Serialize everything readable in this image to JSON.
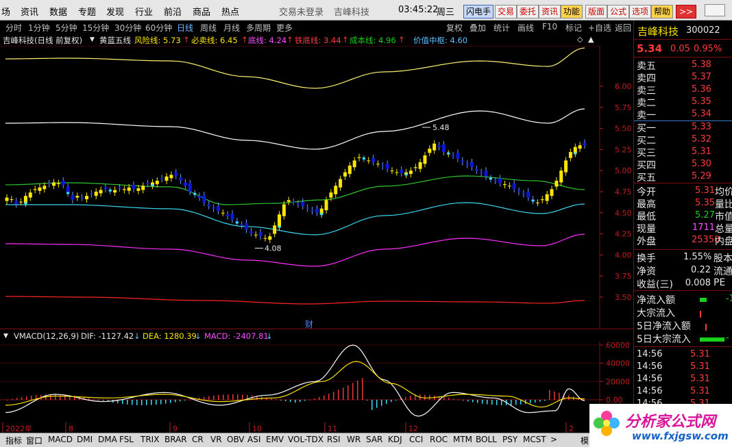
{
  "menubar": {
    "items": [
      "场",
      "资讯",
      "数据",
      "专题",
      "发现",
      "行业",
      "前沿",
      "商品",
      "热点"
    ],
    "login": "交易未登录",
    "company": "吉峰科技",
    "time": "03:45:22",
    "weekday": "周三",
    "buttons": [
      "闪电手",
      "交易",
      "委托",
      "资讯",
      "功能",
      "版面",
      "公式",
      "选项",
      "帮助",
      ">>"
    ]
  },
  "toolbar": {
    "periods": [
      "分时",
      "1分钟",
      "5分钟",
      "15分钟",
      "30分钟",
      "60分钟",
      "日线",
      "周线",
      "月线",
      "多周期",
      "更多"
    ],
    "active": "日线",
    "right": [
      "复权",
      "叠加",
      "统计",
      "画线",
      "F10",
      "标记",
      "+自选",
      "返回"
    ]
  },
  "infobar": {
    "title": "吉峰科技(日线 前复权)",
    "indicator": "黄蓝五线",
    "risk": "风险线: 5.73",
    "sell": "必卖线: 6.45",
    "bottom": "底线: 4.24",
    "iron": "铁底线: 3.44",
    "cost": "成本线: 4.96",
    "value": "价值中枢: 4.60",
    "arrow": "↑"
  },
  "main_chart": {
    "price_axis": [
      "6.00",
      "5.75",
      "5.50",
      "5.25",
      "5.00",
      "4.75",
      "4.50",
      "4.25",
      "4.00",
      "3.75",
      "3.50"
    ],
    "high_label": "5.48",
    "low_label": "4.08",
    "fin_marker": "财"
  },
  "macd": {
    "name": "VMACD(12,26,9)",
    "dif": "DIF: -1127.42",
    "dea": "DEA: 1280.39",
    "macd": "MACD: -2407.81",
    "axis": [
      "60000",
      "40000",
      "20000",
      "0.00"
    ],
    "dates": [
      "2022年",
      "8",
      "9",
      "10",
      "11",
      "12",
      "2"
    ]
  },
  "bottombar": {
    "tabs": [
      "指标",
      "窗口",
      "MACD",
      "DMI",
      "DMA",
      "FSL",
      "TRIX",
      "BRAR",
      "CR",
      "VR",
      "OBV",
      "ASI",
      "EMV",
      "VOL-TDX",
      "RSI",
      "WR",
      "SAR",
      "KDJ",
      "CCI",
      "ROC",
      "MTM",
      "BOLL",
      "PSY",
      "MCST",
      ">",
      "模"
    ]
  },
  "quote": {
    "name": "吉峰科技",
    "code": "300022",
    "price": "5.34",
    "change": "0.05",
    "pct": "0.95%",
    "asks": [
      {
        "label": "卖五",
        "price": "5.38"
      },
      {
        "label": "卖四",
        "price": "5.37"
      },
      {
        "label": "卖三",
        "price": "5.36"
      },
      {
        "label": "卖二",
        "price": "5.35"
      },
      {
        "label": "卖一",
        "price": "5.34"
      }
    ],
    "bids": [
      {
        "label": "买一",
        "price": "5.33"
      },
      {
        "label": "买二",
        "price": "5.32"
      },
      {
        "label": "买三",
        "price": "5.31"
      },
      {
        "label": "买四",
        "price": "5.30"
      },
      {
        "label": "买五",
        "price": "5.29"
      }
    ],
    "stats": [
      {
        "label": "今开",
        "value": "5.31",
        "extra": "均价"
      },
      {
        "label": "最高",
        "value": "5.35",
        "extra": "量比"
      },
      {
        "label": "最低",
        "value": "5.27",
        "extra": "市值"
      },
      {
        "label": "现量",
        "value": "1711",
        "extra": "总量"
      },
      {
        "label": "外盘",
        "value": "25350",
        "extra": "内盘"
      }
    ],
    "stats2": [
      {
        "label": "换手",
        "value": "1.55%",
        "extra": "股本"
      },
      {
        "label": "净资",
        "value": "0.22",
        "extra": "流通"
      },
      {
        "label": "收益(三)",
        "value": "0.008",
        "extra": "PE"
      }
    ],
    "flows": [
      {
        "label": "净流入额",
        "value": "-1"
      },
      {
        "label": "大宗流入",
        "value": ""
      },
      {
        "label": "5日净流入额",
        "value": ""
      },
      {
        "label": "5日大宗流入",
        "value": "-"
      }
    ],
    "ticks": [
      {
        "time": "14:56",
        "price": "5.31"
      },
      {
        "time": "14:56",
        "price": "5.31"
      },
      {
        "time": "14:56",
        "price": "5.31"
      },
      {
        "time": "14:56",
        "price": "5.31"
      },
      {
        "time": "14:56",
        "price": "5.31"
      }
    ]
  },
  "logo": {
    "name": "分析家公式网",
    "url": "www.fxjgsw.com"
  },
  "colors": {
    "up": "#ffe600",
    "down": "#0c18d8",
    "background": "#000000",
    "grid": "#7a1010"
  }
}
